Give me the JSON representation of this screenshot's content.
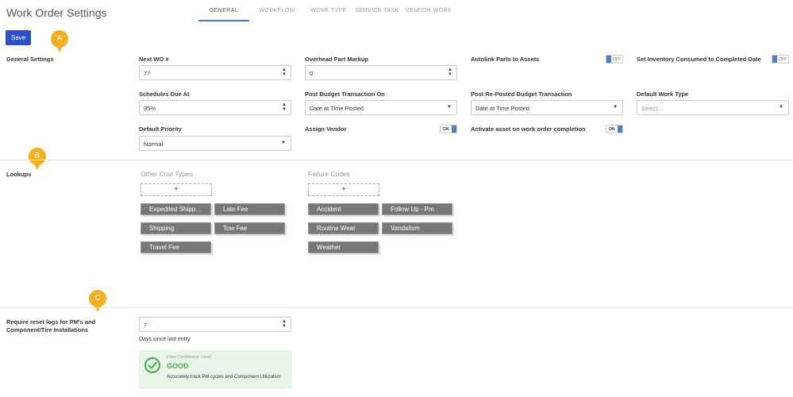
{
  "header": {
    "title": "Work Order Settings",
    "tabs": [
      {
        "label": "GENERAL"
      },
      {
        "label": "WORKFLOW"
      },
      {
        "label": "WORK TYPE"
      },
      {
        "label": "SERVICE TASK"
      },
      {
        "label": "VENDOR WORK"
      }
    ],
    "active_tab": "GENERAL"
  },
  "toolbar": {
    "save_label": "Save"
  },
  "general": {
    "section_label": "General Settings",
    "next_wo": {
      "label": "Next WO #",
      "value": "77"
    },
    "overhead_markup": {
      "label": "Overhead Part Markup",
      "value": "0"
    },
    "autolink": {
      "label": "Autolink Parts to Assets",
      "state": "OFF"
    },
    "set_inventory": {
      "label": "Set Inventory Consumed to Completed Date",
      "state": "OFF"
    },
    "schedules_due": {
      "label": "Schedules Due At",
      "value": "95%"
    },
    "post_budget": {
      "label": "Post Budget Transaction On",
      "value": "Date at Time Posted"
    },
    "post_reposted": {
      "label": "Post Re-Posted Budget Transaction",
      "value": "Date at Time Posted"
    },
    "default_work_type": {
      "label": "Default Work Type",
      "placeholder": "Select..."
    },
    "default_priority": {
      "label": "Default Priority",
      "value": "Normal"
    },
    "assign_vendor": {
      "label": "Assign Vendor",
      "state": "ON"
    },
    "activate_asset": {
      "label": "Activate asset on work order completion",
      "state": "ON"
    }
  },
  "lookups": {
    "section_label": "Lookups",
    "other_cost_types": {
      "heading": "Other Cost Types",
      "add_symbol": "+",
      "items": [
        "Expedited Shipp...",
        "Late Fee",
        "Shipping",
        "Tow Fee",
        "Travel Fee"
      ]
    },
    "failure_codes": {
      "heading": "Failure Codes",
      "add_symbol": "+",
      "items": [
        "Accident",
        "Follow Up - Pm",
        "Routine Wear",
        "Vandalism",
        "Weather"
      ]
    }
  },
  "reset_logs": {
    "section_label": "Require reset logs for PM's and Component/Tire Installations",
    "value": "7",
    "note": "Days since last entry",
    "confidence": {
      "label": "Data Confidence Level",
      "value": "GOOD",
      "description": "Accurately track PM cycles and Component Utilization"
    }
  },
  "annotations": [
    "A",
    "B",
    "C"
  ],
  "colors": {
    "accent": "#2c4fc4",
    "toggle": "#4a7fc9",
    "pin": "#f5b021",
    "chip": "#777777",
    "good": "#4caf50",
    "confidence_bg": "#e8f5e9"
  }
}
